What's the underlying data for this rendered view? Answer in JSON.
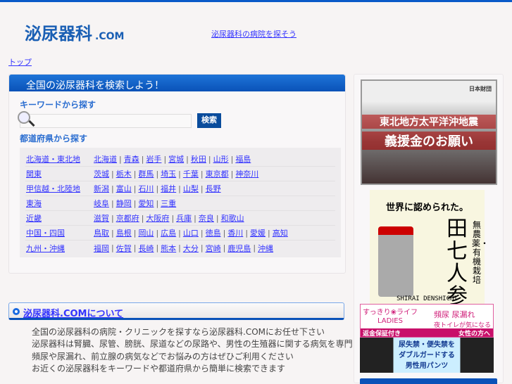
{
  "header": {
    "logo_main": "泌尿器科",
    "logo_suffix": ".COM",
    "link": "泌尿器科の病院を探そう"
  },
  "breadcrumb": "トップ",
  "search_panel": {
    "title": "全国の泌尿器科を検索しよう！",
    "keyword_label": "キーワードから探す",
    "search_placeholder": "",
    "search_button": "検索",
    "prefecture_label": "都道府県から探す",
    "regions": [
      {
        "name": "北海道・東北地",
        "prefs": [
          "北海道",
          "青森",
          "岩手",
          "宮城",
          "秋田",
          "山形",
          "福島"
        ]
      },
      {
        "name": "関東",
        "prefs": [
          "茨城",
          "栃木",
          "群馬",
          "埼玉",
          "千葉",
          "東京都",
          "神奈川"
        ]
      },
      {
        "name": "甲信越・北陸地",
        "prefs": [
          "新潟",
          "富山",
          "石川",
          "福井",
          "山梨",
          "長野"
        ]
      },
      {
        "name": "東海",
        "prefs": [
          "岐阜",
          "静岡",
          "愛知",
          "三重"
        ]
      },
      {
        "name": "近畿",
        "prefs": [
          "滋賀",
          "京都府",
          "大阪府",
          "兵庫",
          "奈良",
          "和歌山"
        ]
      },
      {
        "name": "中国・四国",
        "prefs": [
          "鳥取",
          "島根",
          "岡山",
          "広島",
          "山口",
          "徳島",
          "香川",
          "愛媛",
          "高知"
        ]
      },
      {
        "name": "九州・沖縄",
        "prefs": [
          "福岡",
          "佐賀",
          "長崎",
          "熊本",
          "大分",
          "宮崎",
          "鹿児島",
          "沖縄"
        ]
      }
    ]
  },
  "about": {
    "title": "泌尿器科.COMについて",
    "lines": [
      "全国の泌尿器科の病院・クリニックを探すなら泌尿器科.COMにお任せ下さい",
      "泌尿器科は腎臓、尿管、膀胱、尿道などの尿路や、男性の生殖器に関する病気を専門に診療する診療科です。お気軽にご相談",
      "頻尿や尿漏れ、前立腺の病気などでお悩みの方はぜひご利用ください",
      "お近くの泌尿器科をキーワードや都道府県から簡単に検索できます"
    ]
  },
  "sidebar": {
    "ad1": {
      "org": "日本財団",
      "line1": "東北地方太平洋沖地震",
      "line2": "義援金のお願い"
    },
    "ad2": {
      "headline": "世界に認められた。",
      "product": "田七人参",
      "sub": "無農薬・有機栽培",
      "brand": "SHIRAI DENSHICHI"
    },
    "ad3": {
      "brand": "すっきり❀ライフ",
      "sub": "LADIES",
      "right1": "頻尿 尿漏れ",
      "right2": "夜トイレが気になる",
      "bar_left": "返金保証付き",
      "bar_right": "女性の方へ"
    },
    "ad4": {
      "line1": "尿失禁・便失禁を",
      "line2": "ダブルガードする",
      "line3": "男性用パンツ"
    }
  }
}
